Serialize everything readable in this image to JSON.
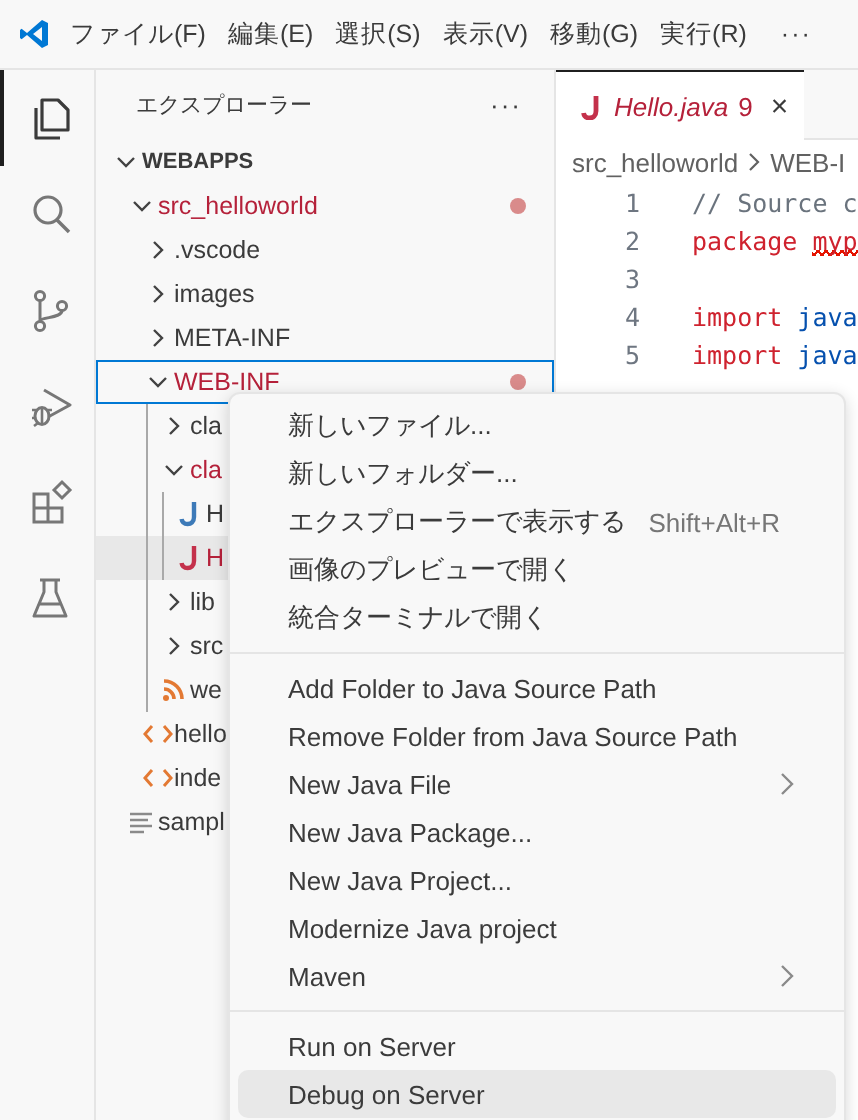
{
  "title_bar": {
    "menus": [
      "ファイル(F)",
      "編集(E)",
      "選択(S)",
      "表示(V)",
      "移動(G)",
      "実行(R)"
    ],
    "more": "···"
  },
  "activity_bar": [
    {
      "kind": "explorer",
      "selected": true
    },
    {
      "kind": "search",
      "selected": false
    },
    {
      "kind": "source-control",
      "selected": false
    },
    {
      "kind": "run-debug",
      "selected": false
    },
    {
      "kind": "extensions",
      "selected": false
    },
    {
      "kind": "testing",
      "selected": false
    }
  ],
  "sidebar": {
    "title": "エクスプローラー",
    "more": "···",
    "section": {
      "label": "WEBAPPS",
      "expanded": true,
      "items": [
        {
          "label": "src_helloworld",
          "kind": "folder",
          "expanded": true,
          "error": true,
          "dot": true,
          "selected": false,
          "hovered": false,
          "children": [
            {
              "label": ".vscode",
              "kind": "folder",
              "expanded": false,
              "error": false,
              "selected": false,
              "hovered": false
            },
            {
              "label": "images",
              "kind": "folder",
              "expanded": false,
              "error": false,
              "selected": false,
              "hovered": false
            },
            {
              "label": "META-INF",
              "kind": "folder",
              "expanded": false,
              "error": false,
              "selected": false,
              "hovered": false
            },
            {
              "label": "WEB-INF",
              "kind": "folder",
              "expanded": true,
              "error": true,
              "dot": true,
              "selected": true,
              "hovered": false,
              "children": [
                {
                  "label": "cla",
                  "kind": "folder",
                  "expanded": false,
                  "error": false,
                  "selected": false,
                  "hovered": false
                },
                {
                  "label": "cla",
                  "kind": "folder",
                  "expanded": true,
                  "error": true,
                  "selected": false,
                  "hovered": false,
                  "children": [
                    {
                      "label": "H",
                      "kind": "java",
                      "error": false,
                      "selected": false,
                      "hovered": false
                    },
                    {
                      "label": "H",
                      "kind": "java",
                      "error": true,
                      "selected": false,
                      "hovered": true
                    }
                  ]
                },
                {
                  "label": "lib",
                  "kind": "folder",
                  "expanded": false,
                  "error": false,
                  "selected": false,
                  "hovered": false
                },
                {
                  "label": "src",
                  "kind": "folder",
                  "expanded": false,
                  "error": false,
                  "selected": false,
                  "hovered": false
                },
                {
                  "label": "we",
                  "kind": "rss",
                  "error": false,
                  "selected": false,
                  "hovered": false
                }
              ]
            },
            {
              "label": "hello",
              "kind": "xml",
              "error": false,
              "selected": false,
              "hovered": false
            },
            {
              "label": "inde",
              "kind": "xml",
              "error": false,
              "selected": false,
              "hovered": false
            }
          ]
        },
        {
          "label": "sampl",
          "kind": "text",
          "error": false,
          "selected": false,
          "hovered": false
        }
      ]
    }
  },
  "editor": {
    "tab": {
      "label": "Hello.java",
      "problems": "9",
      "error": true,
      "selected": true,
      "close": "×"
    },
    "breadcrumb": [
      "src_helloworld",
      "WEB-I"
    ],
    "lines": [
      {
        "number": "1",
        "tokens": [
          {
            "text": "// Source c",
            "kind": "comment"
          }
        ]
      },
      {
        "number": "2",
        "tokens": [
          {
            "text": "package",
            "kind": "keyword"
          },
          {
            "text": "myp",
            "kind": "identifier",
            "error": true
          }
        ]
      },
      {
        "number": "3"
      },
      {
        "number": "4",
        "tokens": [
          {
            "text": "import",
            "kind": "keyword"
          },
          {
            "text": "java",
            "kind": "namespace"
          }
        ]
      },
      {
        "number": "5",
        "tokens": [
          {
            "text": "import",
            "kind": "keyword"
          },
          {
            "text": "java",
            "kind": "namespace"
          }
        ]
      }
    ]
  },
  "context_menu": {
    "groups": [
      [
        {
          "label": "新しいファイル...",
          "submenu": false,
          "selected": false
        },
        {
          "label": "新しいフォルダー...",
          "submenu": false,
          "selected": false
        },
        {
          "label": "エクスプローラーで表示する",
          "shortcut": "Shift+Alt+R",
          "submenu": false,
          "selected": false
        },
        {
          "label": "画像のプレビューで開く",
          "submenu": false,
          "selected": false
        },
        {
          "label": "統合ターミナルで開く",
          "submenu": false,
          "selected": false
        }
      ],
      [
        {
          "label": "Add Folder to Java Source Path",
          "submenu": false,
          "selected": false
        },
        {
          "label": "Remove Folder from Java Source Path",
          "submenu": false,
          "selected": false
        },
        {
          "label": "New Java File",
          "submenu": true,
          "selected": false
        },
        {
          "label": "New Java Package...",
          "submenu": false,
          "selected": false
        },
        {
          "label": "New Java Project...",
          "submenu": false,
          "selected": false
        },
        {
          "label": "Modernize Java project",
          "submenu": false,
          "selected": false
        },
        {
          "label": "Maven",
          "submenu": true,
          "selected": false
        }
      ],
      [
        {
          "label": "Run on Server",
          "submenu": false,
          "selected": false
        },
        {
          "label": "Debug on Server",
          "submenu": false,
          "selected": true
        }
      ]
    ]
  }
}
